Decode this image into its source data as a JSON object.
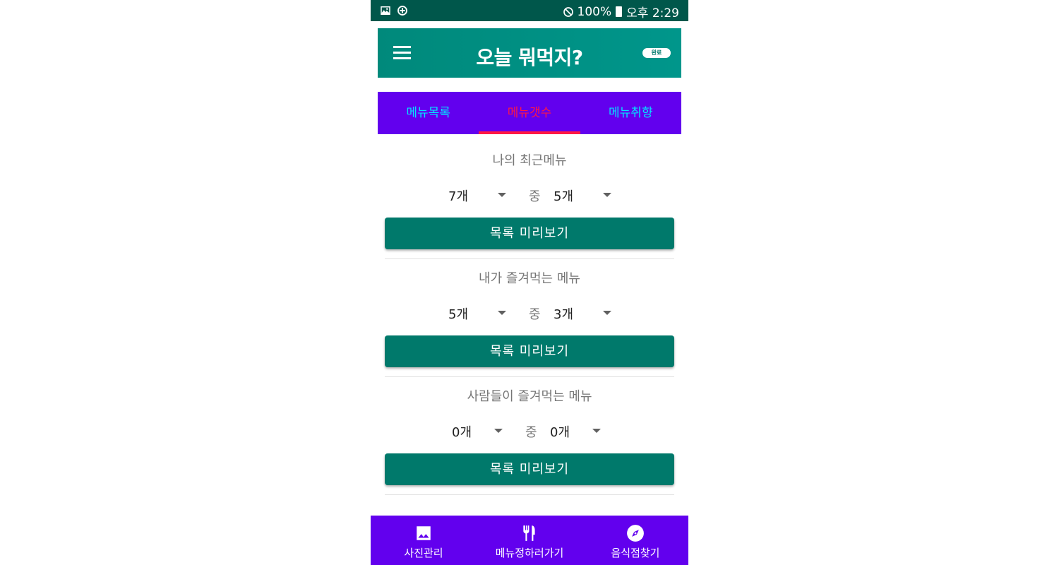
{
  "status_bar": {
    "battery": "100%",
    "time": "오후 2:29",
    "icons_left": [
      "image-icon",
      "data-saver-icon"
    ],
    "icons_right": [
      "do-not-disturb-icon",
      "battery-icon"
    ]
  },
  "app_bar": {
    "title": "오늘 뭐먹지?",
    "done_label": "완료"
  },
  "tabs": [
    {
      "label": "메뉴목록",
      "active": false
    },
    {
      "label": "메뉴갯수",
      "active": true
    },
    {
      "label": "메뉴취향",
      "active": false
    }
  ],
  "sections": [
    {
      "title": "나의 최근메뉴",
      "total": "7개",
      "middle": "중",
      "pick": "5개",
      "button": "목록 미리보기"
    },
    {
      "title": "내가 즐겨먹는 메뉴",
      "total": "5개",
      "middle": "중",
      "pick": "3개",
      "button": "목록 미리보기"
    },
    {
      "title": "사람들이 즐겨먹는 메뉴",
      "total": "0개",
      "middle": "중",
      "pick": "0개",
      "button": "목록 미리보기"
    }
  ],
  "bottom_nav": [
    {
      "label": "사진관리",
      "icon": "image-icon"
    },
    {
      "label": "메뉴정하러가기",
      "icon": "restaurant-icon"
    },
    {
      "label": "음식점찾기",
      "icon": "compass-icon"
    }
  ],
  "colors": {
    "status_bar": "#00574b",
    "app_bar": "#00897b",
    "tabs_bg": "#6200ee",
    "tab_text": "#00e5ff",
    "tab_active": "#ff1744",
    "button": "#00796b",
    "bottom_nav": "#6200ee"
  }
}
